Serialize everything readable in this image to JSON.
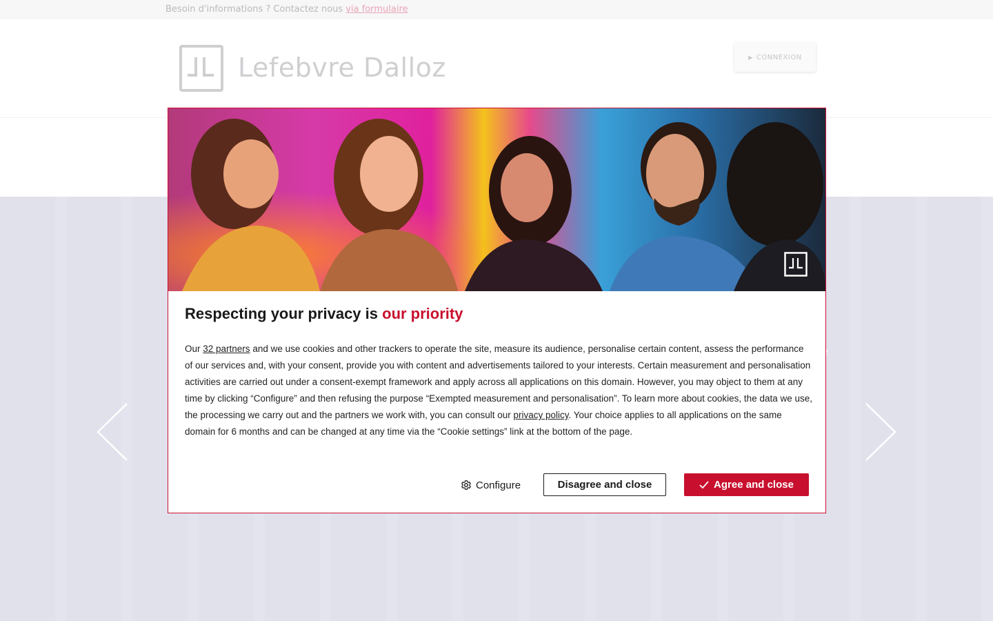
{
  "topbar": {
    "text": "Besoin d'informations ? Contactez nous",
    "link": "via formulaire"
  },
  "header": {
    "logo_text": "Lefebvre Dalloz",
    "login_label": "CONNEXION",
    "login_icon": "triangle-right-icon"
  },
  "hero": {
    "ghost_char": "e",
    "prev_icon": "chevron-left-icon",
    "next_icon": "chevron-right-icon"
  },
  "modal": {
    "title_plain": "Respecting your privacy is",
    "title_accent": "our priority",
    "body": {
      "part1": "Our ",
      "partners_link": "32 partners",
      "part2": " and we use cookies and other trackers to operate the site, measure its audience, personalise certain content, assess the performance of our services and, with your consent, provide you with content and advertisements tailored to your interests. Certain measurement and personalisation activities are carried out under a consent-exempt framework and apply across all applications on this domain. However, you may object to them at any time by clicking “Configure” and then refusing the purpose “Exempted measurement and personalisation”. To learn more about cookies, the data we use, the processing we carry out and the partners we work with, you can consult our ",
      "privacy_link": "privacy policy",
      "part3": ". Your choice applies to all applications on the same domain for 6 months and can be changed at any time via the “Cookie settings” link at the bottom of the page."
    },
    "configure_label": "Configure",
    "disagree_label": "Disagree and close",
    "agree_label": "Agree and close"
  },
  "colors": {
    "accent": "#c8102e",
    "hero_bg": "#e1e1ec",
    "text": "#1a1a1a"
  }
}
